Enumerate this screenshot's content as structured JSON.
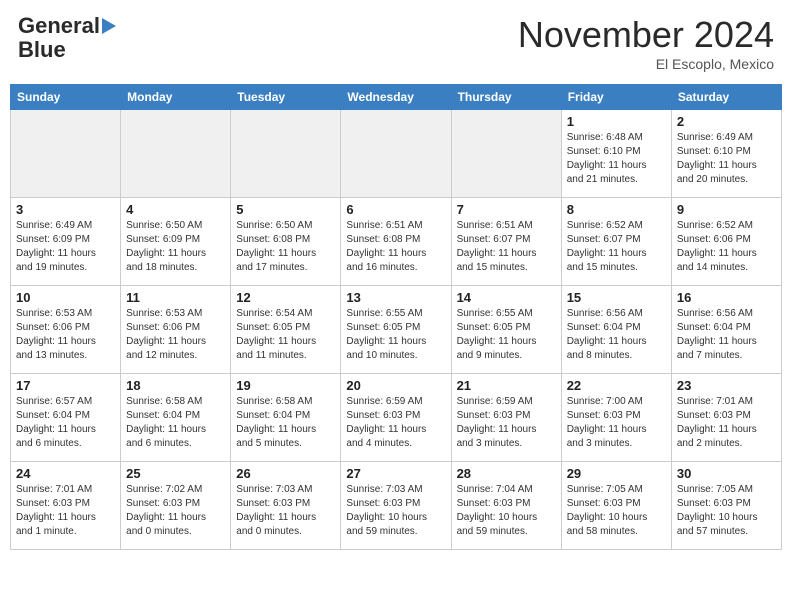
{
  "header": {
    "logo_line1": "General",
    "logo_line2": "Blue",
    "month": "November 2024",
    "location": "El Escoplo, Mexico"
  },
  "weekdays": [
    "Sunday",
    "Monday",
    "Tuesday",
    "Wednesday",
    "Thursday",
    "Friday",
    "Saturday"
  ],
  "weeks": [
    [
      {
        "day": "",
        "info": ""
      },
      {
        "day": "",
        "info": ""
      },
      {
        "day": "",
        "info": ""
      },
      {
        "day": "",
        "info": ""
      },
      {
        "day": "",
        "info": ""
      },
      {
        "day": "1",
        "info": "Sunrise: 6:48 AM\nSunset: 6:10 PM\nDaylight: 11 hours\nand 21 minutes."
      },
      {
        "day": "2",
        "info": "Sunrise: 6:49 AM\nSunset: 6:10 PM\nDaylight: 11 hours\nand 20 minutes."
      }
    ],
    [
      {
        "day": "3",
        "info": "Sunrise: 6:49 AM\nSunset: 6:09 PM\nDaylight: 11 hours\nand 19 minutes."
      },
      {
        "day": "4",
        "info": "Sunrise: 6:50 AM\nSunset: 6:09 PM\nDaylight: 11 hours\nand 18 minutes."
      },
      {
        "day": "5",
        "info": "Sunrise: 6:50 AM\nSunset: 6:08 PM\nDaylight: 11 hours\nand 17 minutes."
      },
      {
        "day": "6",
        "info": "Sunrise: 6:51 AM\nSunset: 6:08 PM\nDaylight: 11 hours\nand 16 minutes."
      },
      {
        "day": "7",
        "info": "Sunrise: 6:51 AM\nSunset: 6:07 PM\nDaylight: 11 hours\nand 15 minutes."
      },
      {
        "day": "8",
        "info": "Sunrise: 6:52 AM\nSunset: 6:07 PM\nDaylight: 11 hours\nand 15 minutes."
      },
      {
        "day": "9",
        "info": "Sunrise: 6:52 AM\nSunset: 6:06 PM\nDaylight: 11 hours\nand 14 minutes."
      }
    ],
    [
      {
        "day": "10",
        "info": "Sunrise: 6:53 AM\nSunset: 6:06 PM\nDaylight: 11 hours\nand 13 minutes."
      },
      {
        "day": "11",
        "info": "Sunrise: 6:53 AM\nSunset: 6:06 PM\nDaylight: 11 hours\nand 12 minutes."
      },
      {
        "day": "12",
        "info": "Sunrise: 6:54 AM\nSunset: 6:05 PM\nDaylight: 11 hours\nand 11 minutes."
      },
      {
        "day": "13",
        "info": "Sunrise: 6:55 AM\nSunset: 6:05 PM\nDaylight: 11 hours\nand 10 minutes."
      },
      {
        "day": "14",
        "info": "Sunrise: 6:55 AM\nSunset: 6:05 PM\nDaylight: 11 hours\nand 9 minutes."
      },
      {
        "day": "15",
        "info": "Sunrise: 6:56 AM\nSunset: 6:04 PM\nDaylight: 11 hours\nand 8 minutes."
      },
      {
        "day": "16",
        "info": "Sunrise: 6:56 AM\nSunset: 6:04 PM\nDaylight: 11 hours\nand 7 minutes."
      }
    ],
    [
      {
        "day": "17",
        "info": "Sunrise: 6:57 AM\nSunset: 6:04 PM\nDaylight: 11 hours\nand 6 minutes."
      },
      {
        "day": "18",
        "info": "Sunrise: 6:58 AM\nSunset: 6:04 PM\nDaylight: 11 hours\nand 6 minutes."
      },
      {
        "day": "19",
        "info": "Sunrise: 6:58 AM\nSunset: 6:04 PM\nDaylight: 11 hours\nand 5 minutes."
      },
      {
        "day": "20",
        "info": "Sunrise: 6:59 AM\nSunset: 6:03 PM\nDaylight: 11 hours\nand 4 minutes."
      },
      {
        "day": "21",
        "info": "Sunrise: 6:59 AM\nSunset: 6:03 PM\nDaylight: 11 hours\nand 3 minutes."
      },
      {
        "day": "22",
        "info": "Sunrise: 7:00 AM\nSunset: 6:03 PM\nDaylight: 11 hours\nand 3 minutes."
      },
      {
        "day": "23",
        "info": "Sunrise: 7:01 AM\nSunset: 6:03 PM\nDaylight: 11 hours\nand 2 minutes."
      }
    ],
    [
      {
        "day": "24",
        "info": "Sunrise: 7:01 AM\nSunset: 6:03 PM\nDaylight: 11 hours\nand 1 minute."
      },
      {
        "day": "25",
        "info": "Sunrise: 7:02 AM\nSunset: 6:03 PM\nDaylight: 11 hours\nand 0 minutes."
      },
      {
        "day": "26",
        "info": "Sunrise: 7:03 AM\nSunset: 6:03 PM\nDaylight: 11 hours\nand 0 minutes."
      },
      {
        "day": "27",
        "info": "Sunrise: 7:03 AM\nSunset: 6:03 PM\nDaylight: 10 hours\nand 59 minutes."
      },
      {
        "day": "28",
        "info": "Sunrise: 7:04 AM\nSunset: 6:03 PM\nDaylight: 10 hours\nand 59 minutes."
      },
      {
        "day": "29",
        "info": "Sunrise: 7:05 AM\nSunset: 6:03 PM\nDaylight: 10 hours\nand 58 minutes."
      },
      {
        "day": "30",
        "info": "Sunrise: 7:05 AM\nSunset: 6:03 PM\nDaylight: 10 hours\nand 57 minutes."
      }
    ]
  ]
}
